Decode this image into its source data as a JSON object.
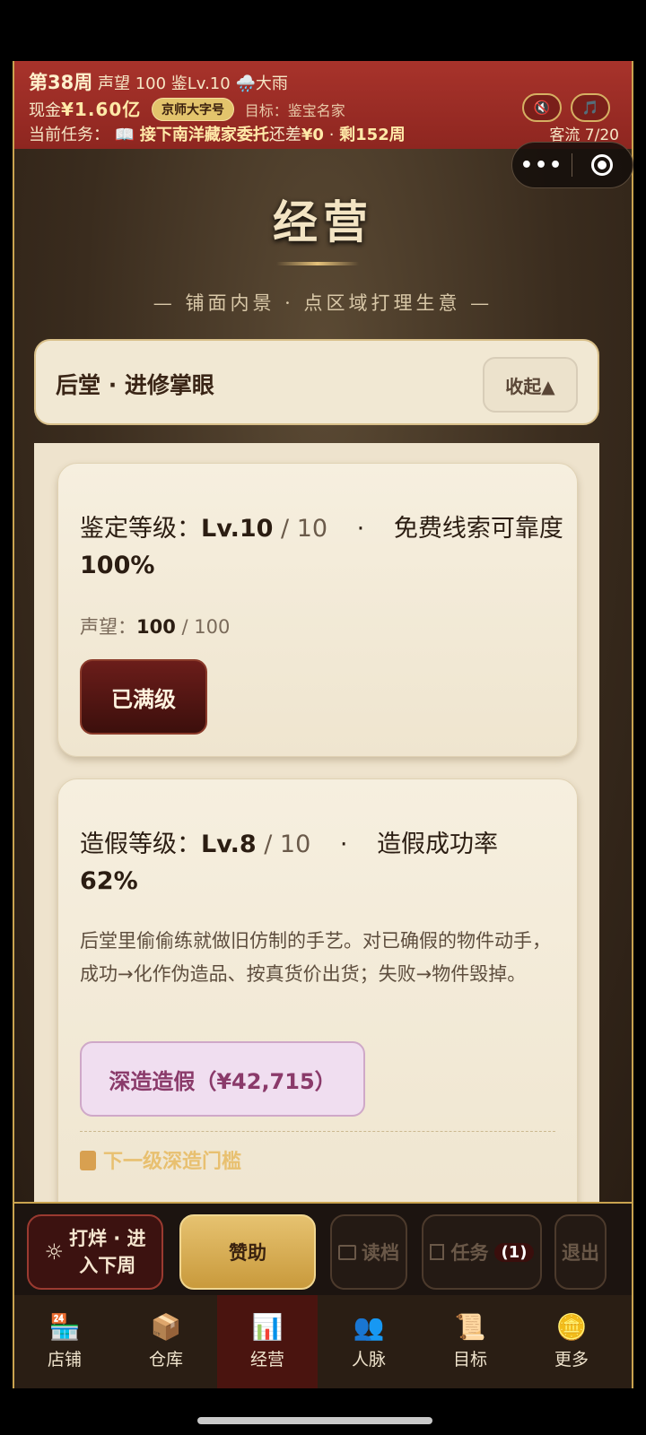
{
  "hud": {
    "week": "第38周",
    "reputation": "声望 100",
    "appraise_level": "鉴Lv.10",
    "weather": "🌧️大雨",
    "cash_label": "现金",
    "cash_value": "¥1.60亿",
    "font_toggle": "京师大字号",
    "goal": "目标：鉴宝名家",
    "task_label": "当前任务：",
    "task_icon": "📖",
    "task_name": "接下南洋藏家委托",
    "task_gap_label": "还差",
    "task_gap_value": "¥0",
    "task_sep": "·",
    "task_remaining": "剩152周",
    "visitors": "客流 7/20",
    "mute_icon": "🔇",
    "music_icon": "🎵"
  },
  "page": {
    "title": "经营",
    "subtitle": "— 铺面内景 · 点区域打理生意 —"
  },
  "section": {
    "label": "后堂 · 进修掌眼",
    "collapse_label": "收起▲"
  },
  "card_appraise": {
    "stat_prefix": "鉴定等级：",
    "level": "Lv.10",
    "max": " / 10",
    "sep": "·",
    "effect_label": "免费线索可靠度",
    "effect_value": "100%",
    "rep_label": "声望：",
    "rep_value": "100",
    "rep_max": " / 100",
    "button": "已满级"
  },
  "card_forge": {
    "stat_prefix": "造假等级：",
    "level": "Lv.8",
    "max": " / 10",
    "sep": "·",
    "effect_label": "造假成功率",
    "effect_value": "62%",
    "description": "后堂里偷偷练就做旧仿制的手艺。对已确假的物件动手，成功→化作伪造品、按真货价出货；失败→物件毁掉。",
    "button": "深造造假（¥42,715）",
    "next_title": "下一级深造门槛"
  },
  "actions": {
    "next_week_icon": "☼",
    "next_week_line1": "打烊 · 进",
    "next_week_line2": "入下周",
    "sponsor": "赞助",
    "load": "读档",
    "task": "任务",
    "task_badge": "(1)",
    "exit": "退出"
  },
  "tabs": [
    {
      "label": "店铺",
      "icon": "🏪"
    },
    {
      "label": "仓库",
      "icon": "📦"
    },
    {
      "label": "经营",
      "icon": "📊"
    },
    {
      "label": "人脉",
      "icon": "👥"
    },
    {
      "label": "目标",
      "icon": "📜"
    },
    {
      "label": "更多",
      "icon": "🪙"
    }
  ]
}
